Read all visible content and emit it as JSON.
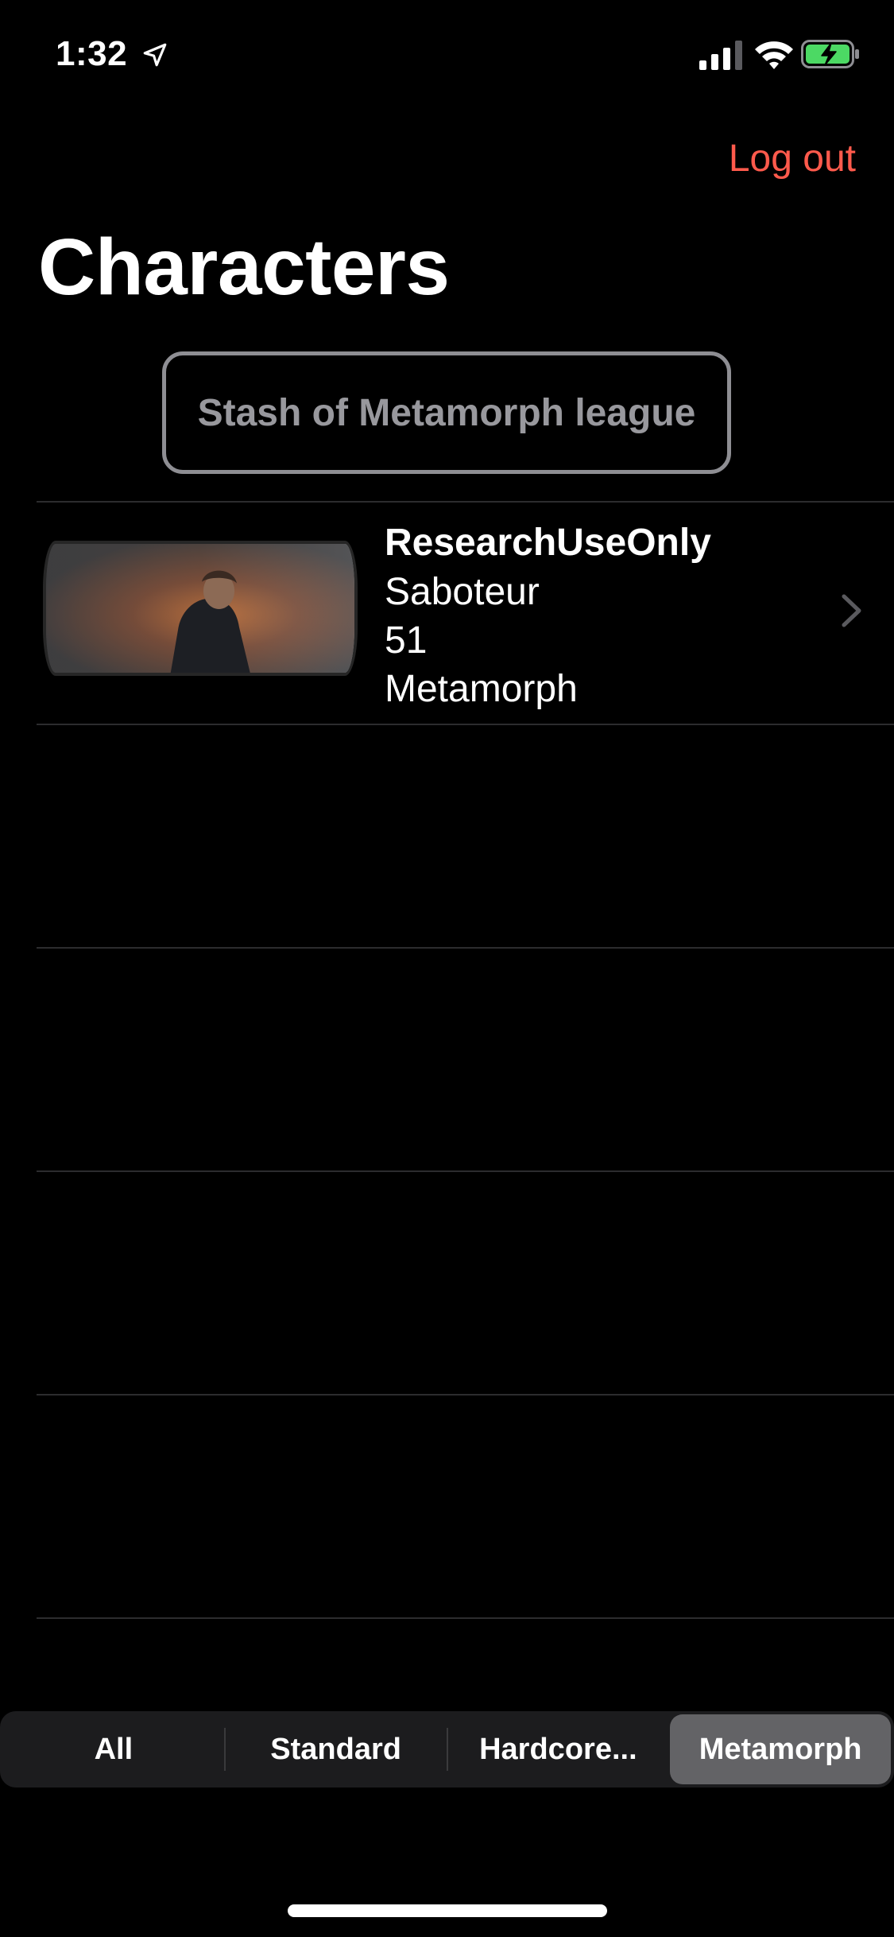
{
  "status_bar": {
    "time": "1:32",
    "icons": [
      "location-arrow-icon",
      "cellular-signal-icon",
      "wifi-icon",
      "battery-charging-icon"
    ]
  },
  "header": {
    "logout_label": "Log out",
    "title": "Characters"
  },
  "stash_button": {
    "label": "Stash of Metamorph league"
  },
  "characters": [
    {
      "name": "ResearchUseOnly",
      "class": "Saboteur",
      "level": "51",
      "league": "Metamorph"
    }
  ],
  "league_filter": {
    "options": [
      "All",
      "Standard",
      "Hardcore...",
      "Metamorph"
    ],
    "selected": "Metamorph"
  },
  "colors": {
    "accent": "#ff5a4c",
    "background": "#000000",
    "segment_selected": "#636366",
    "segment_background": "#1c1c1e"
  }
}
